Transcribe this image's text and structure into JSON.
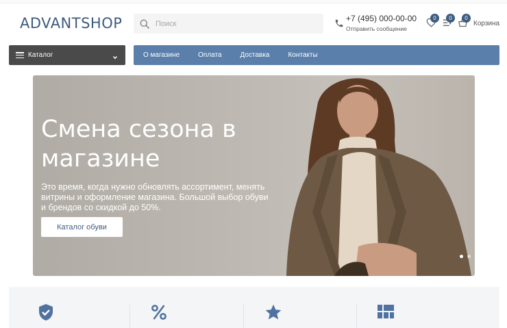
{
  "header": {
    "logo": "ADVANTSHOP",
    "search_placeholder": "Поиск",
    "phone": "+7 (495) 000-00-00",
    "send_message": "Отправить сообщение",
    "wishlist_count": "0",
    "compare_count": "0",
    "cart_count": "0",
    "cart_label": "Корзина"
  },
  "navbar": {
    "catalog_label": "Каталог",
    "links": [
      "О магазине",
      "Оплата",
      "Доставка",
      "Контакты"
    ]
  },
  "banner": {
    "title": "Смена сезона в магазине",
    "text": "Это время, когда нужно обновлять ассортимент, менять витрины и оформление магазина. Большой выбор обуви и брендов со скидкой до 50%.",
    "button_label": "Каталог обуви",
    "slide_count": 2,
    "active_slide": 1
  },
  "features": {
    "icons": [
      "shield-check-icon",
      "percent-icon",
      "star-icon",
      "layout-grid-icon"
    ]
  },
  "colors": {
    "brand": "#3e5b80",
    "nav_bg": "#5a7fab",
    "catalog_bg": "#4a4a4a"
  }
}
